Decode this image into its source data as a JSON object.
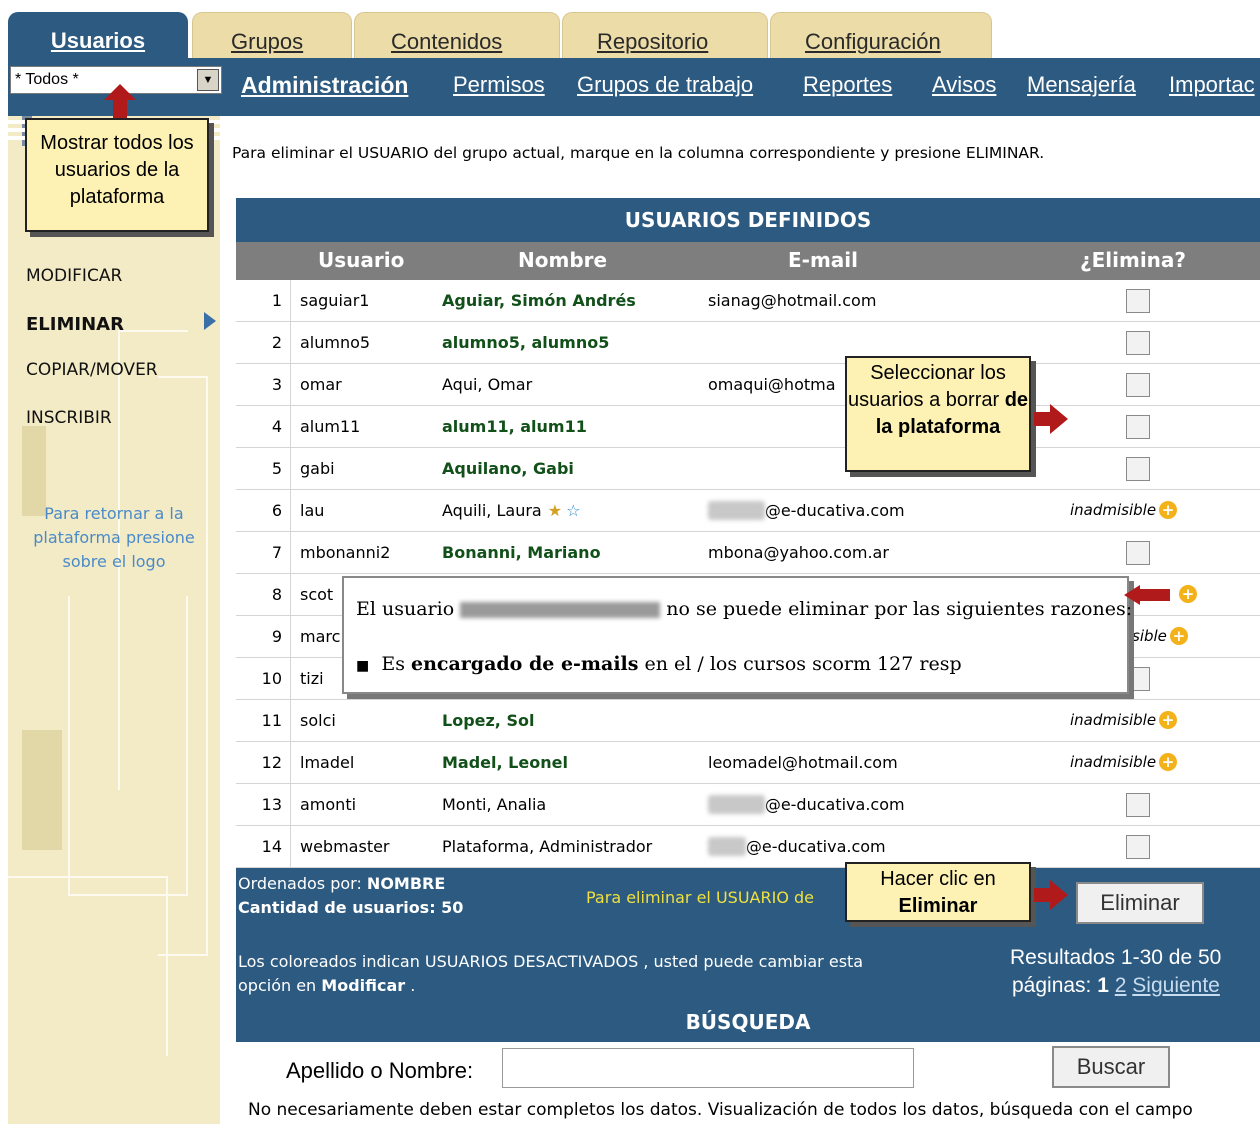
{
  "tabs": [
    {
      "label": "Usuarios",
      "active": true
    },
    {
      "label": "Grupos",
      "active": false
    },
    {
      "label": "Contenidos",
      "active": false
    },
    {
      "label": "Repositorio",
      "active": false
    },
    {
      "label": "Configuración",
      "active": false
    }
  ],
  "user_select": {
    "value": "* Todos *",
    "arrow_icon": "dropdown-arrow-icon"
  },
  "subnav": {
    "items": [
      "Administración",
      "Permisos",
      "Grupos de trabajo",
      "Reportes",
      "Avisos",
      "Mensajería",
      "Importac"
    ]
  },
  "sidebar": {
    "items": [
      {
        "label": "MODIFICAR",
        "active": false
      },
      {
        "label": "ELIMINAR",
        "active": true
      },
      {
        "label": "COPIAR/MOVER",
        "active": false
      },
      {
        "label": "INSCRIBIR",
        "active": false
      }
    ],
    "hint": "Para retornar a la plataforma presione sobre el logo"
  },
  "instruction": "Para eliminar el USUARIO del grupo actual, marque en la columna correspondiente y presione ELIMINAR.",
  "table": {
    "title": "USUARIOS DEFINIDOS",
    "headers": [
      "Usuario",
      "Nombre",
      "E-mail",
      "¿Elimina?"
    ],
    "rows": [
      {
        "num": "1",
        "user": "saguiar1",
        "name": "Aguiar, Simón Andrés",
        "email": "sianag@hotmail.com",
        "action": "checkbox"
      },
      {
        "num": "2",
        "user": "alumno5",
        "name": "alumno5, alumno5",
        "email": "",
        "action": "checkbox"
      },
      {
        "num": "3",
        "user": "omar",
        "name": "Aqui, Omar",
        "email": "omaqui@hotma",
        "action": "checkbox"
      },
      {
        "num": "4",
        "user": "alum11",
        "name": "alum11, alum11",
        "email": "",
        "action": "checkbox"
      },
      {
        "num": "5",
        "user": "gabi",
        "name": "Aquilano, Gabi",
        "email": "",
        "action": "checkbox"
      },
      {
        "num": "6",
        "user": "lau",
        "name": "Aquili, Laura",
        "email": "@e-ducativa.com",
        "action": "inadmisible"
      },
      {
        "num": "7",
        "user": "mbonanni2",
        "name": "Bonanni, Mariano",
        "email": "mbona@yahoo.com.ar",
        "action": "checkbox"
      },
      {
        "num": "8",
        "user": "scot",
        "name": "",
        "email": "",
        "action": "plus"
      },
      {
        "num": "9",
        "user": "marc",
        "name": "",
        "email": "",
        "action": "inadmisible-partial"
      },
      {
        "num": "10",
        "user": "tizi",
        "name": "",
        "email": "",
        "action": "checkbox"
      },
      {
        "num": "11",
        "user": "solci",
        "name": "Lopez, Sol",
        "email": "",
        "action": "inadmisible"
      },
      {
        "num": "12",
        "user": "lmadel",
        "name": "Madel, Leonel",
        "email": "leomadel@hotmail.com",
        "action": "inadmisible"
      },
      {
        "num": "13",
        "user": "amonti",
        "name": "Monti, Analia",
        "email": "@e-ducativa.com",
        "action": "checkbox"
      },
      {
        "num": "14",
        "user": "webmaster",
        "name": "Plataforma, Administrador",
        "email": "@e-ducativa.com",
        "action": "checkbox"
      }
    ],
    "inadmisible_label": "inadmisible",
    "inadmisible_partial_label": "sible"
  },
  "footer": {
    "ordered_label": "Ordenados por: ",
    "ordered_value": "NOMBRE",
    "count_label": "Cantidad de usuarios: 50",
    "yellow_note": "Para eliminar el USUARIO de",
    "eliminar_button": "Eliminar",
    "colored_note_1": "Los coloreados indican USUARIOS DESACTIVADOS , usted puede cambiar esta",
    "colored_note_2a": "opción en ",
    "colored_note_2b": "Modificar",
    "colored_note_2c": " .",
    "results": "Resultados 1-30 de 50",
    "pages_label": "páginas: ",
    "page_current": "1",
    "page_2": "2",
    "next": "Siguiente"
  },
  "search": {
    "title": "BÚSQUEDA",
    "label": "Apellido o Nombre:",
    "input_value": "",
    "button": "Buscar",
    "note": "No necesariamente deben estar completos los datos. Visualización de todos los datos, búsqueda con el campo"
  },
  "callouts": {
    "todos": "Mostrar todos los usuarios de la plataforma",
    "seleccionar_1": "Seleccionar los usuarios a borrar ",
    "seleccionar_2": "de la plataforma",
    "clic_1": "Hacer clic en",
    "clic_2": "Eliminar"
  },
  "popup": {
    "line1_a": "El usuario ",
    "line1_b": " no se puede eliminar por las siguientes razones:",
    "line2_a": "Es ",
    "line2_b": "encargado de e-mails",
    "line2_c": " en el / los cursos scorm 127 resp"
  },
  "colors": {
    "nav_blue": "#2c5a80",
    "tab_beige": "#ecdca8",
    "sidebar_beige": "#f3ebc6",
    "callout_yellow": "#fdf2b4",
    "arrow_red": "#b01a1a",
    "warn_orange": "#f4b21a"
  }
}
